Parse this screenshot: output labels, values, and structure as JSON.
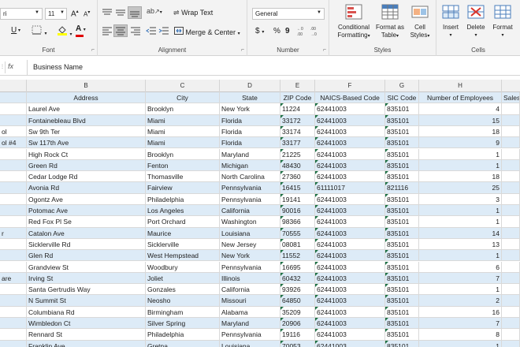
{
  "ribbon": {
    "font": {
      "name": "ri",
      "size": "11",
      "grow_label": "A",
      "shrink_label": "A",
      "underline": "U",
      "group_label": "Font"
    },
    "alignment": {
      "wrap_text": "Wrap Text",
      "merge_center": "Merge & Center",
      "group_label": "Alignment"
    },
    "number": {
      "format": "General",
      "currency": "$",
      "percent": "%",
      "comma": "9",
      "group_label": "Number"
    },
    "styles": {
      "conditional_formatting": [
        "Conditional",
        "Formatting"
      ],
      "format_as_table": [
        "Format as",
        "Table"
      ],
      "cell_styles": [
        "Cell",
        "Styles"
      ],
      "group_label": "Styles"
    },
    "cells": {
      "insert": "Insert",
      "delete": "Delete",
      "format": "Format",
      "group_label": "Cells"
    }
  },
  "formula_bar": {
    "fx": "fx",
    "value": "Business Name"
  },
  "columns": [
    "B",
    "C",
    "D",
    "E",
    "F",
    "G",
    "H"
  ],
  "header_row": [
    "Address",
    "City",
    "State",
    "ZIP Code",
    "NAICS-Based Code",
    "SIC Code",
    "Number of Employees",
    "Sales"
  ],
  "rows": [
    [
      "",
      "Laurel Ave",
      "Brooklyn",
      "New York",
      "11224",
      "62441003",
      "835101",
      "4"
    ],
    [
      "",
      "Fontainebleau Blvd",
      "Miami",
      "Florida",
      "33172",
      "62441003",
      "835101",
      "15"
    ],
    [
      "ol",
      "Sw 9th Ter",
      "Miami",
      "Florida",
      "33174",
      "62441003",
      "835101",
      "18"
    ],
    [
      "ol #4",
      "Sw 117th Ave",
      "Miami",
      "Florida",
      "33177",
      "62441003",
      "835101",
      "9"
    ],
    [
      "",
      "High Rock Ct",
      "Brooklyn",
      "Maryland",
      "21225",
      "62441003",
      "835101",
      "1"
    ],
    [
      "",
      "Green Rd",
      "Fenton",
      "Michigan",
      "48430",
      "62441003",
      "835101",
      "1"
    ],
    [
      "",
      "Cedar Lodge Rd",
      "Thomasville",
      "North Carolina",
      "27360",
      "62441003",
      "835101",
      "18"
    ],
    [
      "",
      "Avonia Rd",
      "Fairview",
      "Pennsylvania",
      "16415",
      "61111017",
      "821116",
      "25"
    ],
    [
      "",
      "Ogontz Ave",
      "Philadelphia",
      "Pennsylvania",
      "19141",
      "62441003",
      "835101",
      "3"
    ],
    [
      "",
      "Potomac Ave",
      "Los Angeles",
      "California",
      "90016",
      "62441003",
      "835101",
      "1"
    ],
    [
      "",
      "Red Fox Pl Se",
      "Port Orchard",
      "Washington",
      "98366",
      "62441003",
      "835101",
      "1"
    ],
    [
      "r",
      "Catalon Ave",
      "Maurice",
      "Louisiana",
      "70555",
      "62441003",
      "835101",
      "14"
    ],
    [
      "",
      "Sicklerville Rd",
      "Sicklerville",
      "New Jersey",
      "08081",
      "62441003",
      "835101",
      "13"
    ],
    [
      "",
      "Glen Rd",
      "West Hempstead",
      "New York",
      "11552",
      "62441003",
      "835101",
      "1"
    ],
    [
      "",
      "Grandview St",
      "Woodbury",
      "Pennsylvania",
      "16695",
      "62441003",
      "835101",
      "6"
    ],
    [
      "are",
      "Irving St",
      "Joliet",
      "Illinois",
      "60432",
      "62441003",
      "835101",
      "7"
    ],
    [
      "",
      "Santa Gertrudis Way",
      "Gonzales",
      "California",
      "93926",
      "62441003",
      "835101",
      "1"
    ],
    [
      "",
      "N Summit St",
      "Neosho",
      "Missouri",
      "64850",
      "62441003",
      "835101",
      "2"
    ],
    [
      "",
      "Columbiana Rd",
      "Birmingham",
      "Alabama",
      "35209",
      "62441003",
      "835101",
      "16"
    ],
    [
      "",
      "Wimbledon Ct",
      "Silver Spring",
      "Maryland",
      "20906",
      "62441003",
      "835101",
      "7"
    ],
    [
      "",
      "Rennard St",
      "Philadelphia",
      "Pennsylvania",
      "19116",
      "62441003",
      "835101",
      "8"
    ],
    [
      "",
      "Franklin Ave",
      "Gretna",
      "Louisiana",
      "70053",
      "62441003",
      "835101",
      "1"
    ]
  ]
}
